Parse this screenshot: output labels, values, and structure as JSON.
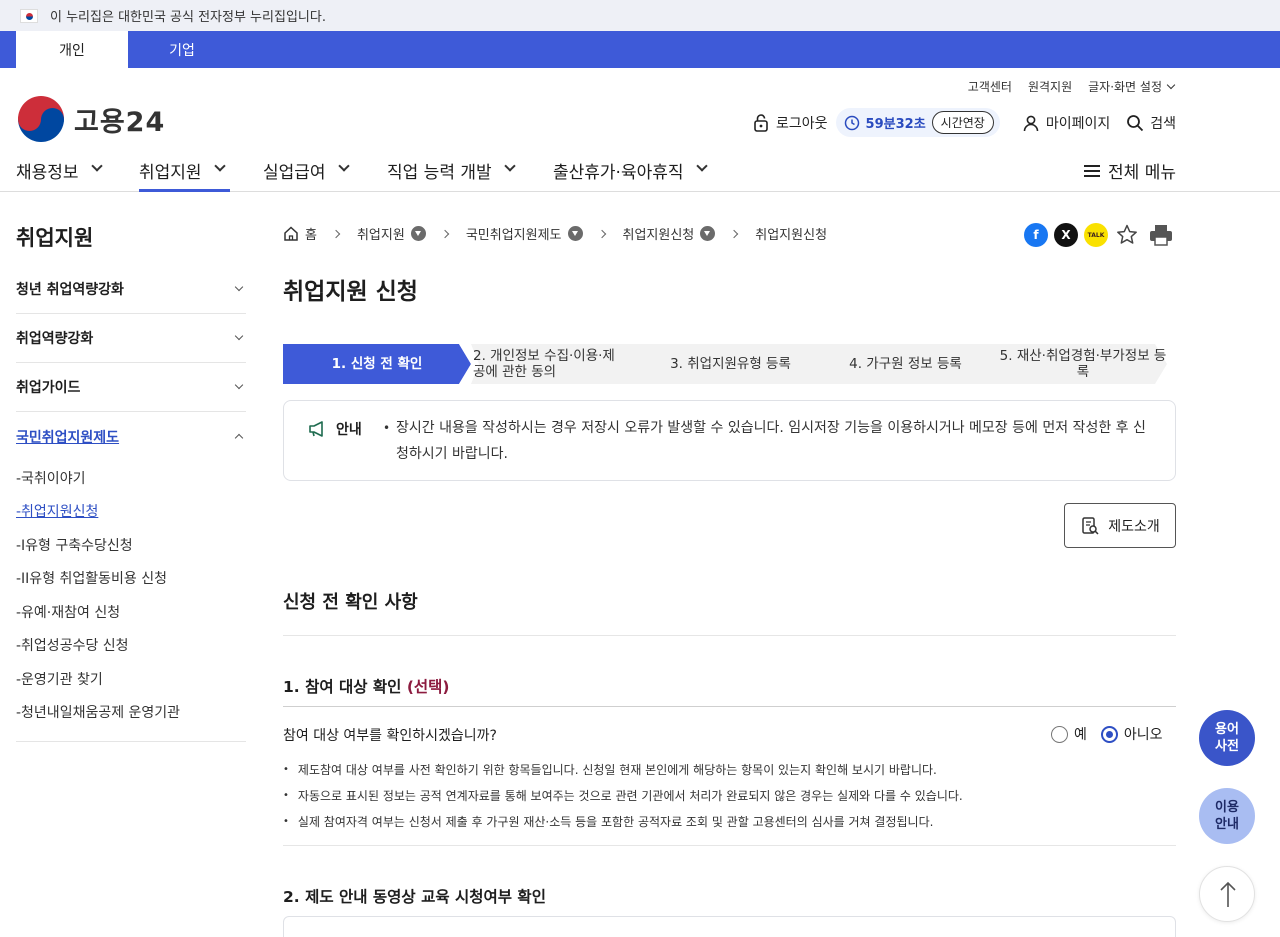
{
  "gov_banner": {
    "text": "이 누리집은 대한민국 공식 전자정부 누리집입니다."
  },
  "user_tabs": [
    {
      "label": "개인",
      "active": true
    },
    {
      "label": "기업",
      "active": false
    }
  ],
  "util_links": {
    "customer_center": "고객센터",
    "remote_support": "원격지원",
    "display_settings": "글자·화면 설정"
  },
  "logo": {
    "text": "고용24"
  },
  "header_actions": {
    "logout": "로그아웃",
    "timer": "59분32초",
    "extend": "시간연장",
    "mypage": "마이페이지",
    "search": "검색"
  },
  "gnb": {
    "items": [
      {
        "label": "채용정보",
        "active": false
      },
      {
        "label": "취업지원",
        "active": true
      },
      {
        "label": "실업급여",
        "active": false
      },
      {
        "label": "직업 능력 개발",
        "active": false
      },
      {
        "label": "출산휴가·육아휴직",
        "active": false
      }
    ],
    "all_menu": "전체 메뉴"
  },
  "lnb": {
    "title": "취업지원",
    "groups": [
      "청년 취업역량강화",
      "취업역량강화",
      "취업가이드",
      "국민취업지원제도"
    ],
    "sub_items": [
      "-국취이야기",
      "-취업지원신청",
      "-I유형 구축수당신청",
      "-II유형 취업활동비용 신청",
      "-유예·재참여 신청",
      "-취업성공수당 신청",
      "-운영기관 찾기",
      "-청년내일채움공제 운영기관"
    ],
    "current_sub": 1
  },
  "breadcrumb": [
    "홈",
    "취업지원",
    "국민취업지원제도",
    "취업지원신청",
    "취업지원신청"
  ],
  "share": {
    "facebook": "f",
    "x": "X",
    "kakao": "TALK"
  },
  "page_title": "취업지원 신청",
  "steps": [
    "1. 신청 전 확인",
    "2. 개인정보 수집·이용·제공에 관한 동의",
    "3. 취업지원유형 등록",
    "4. 가구원 정보 등록",
    "5. 재산·취업경험·부가정보 등록"
  ],
  "notice": {
    "label": "안내",
    "text": "장시간 내용을 작성하시는 경우 저장시 오류가 발생할 수 있습니다. 임시저장 기능을 이용하시거나 메모장 등에 먼저 작성한 후 신청하시기 바랍니다."
  },
  "intro_button": "제도소개",
  "section_title": "신청 전 확인 사항",
  "q1": {
    "title": "1. 참여 대상 확인 ",
    "title_optional": "(선택)",
    "question": "참여 대상 여부를 확인하시겠습니까?",
    "options": [
      {
        "label": "예",
        "selected": false
      },
      {
        "label": "아니오",
        "selected": true
      }
    ],
    "bullets": [
      "제도참여 대상 여부를 사전 확인하기 위한 항목들입니다. 신청일 현재 본인에게 해당하는 항목이 있는지 확인해 보시기 바랍니다.",
      "자동으로 표시된 정보는 공적 연계자료를 통해 보여주는 것으로 관련 기관에서 처리가 완료되지 않은 경우는 실제와 다를 수 있습니다.",
      "실제 참여자격 여부는 신청서 제출 후 가구원 재산·소득 등을 포함한 공적자료 조회 및 관할 고용센터의 심사를 거쳐 결정됩니다."
    ]
  },
  "q2": {
    "title": "2. 제도 안내 동영상 교육 시청여부 확인"
  },
  "floating": {
    "glossary_line1": "용어",
    "glossary_line2": "사전",
    "guide_line1": "이용",
    "guide_line2": "안내"
  },
  "colors": {
    "primary": "#3e5ad8",
    "link": "#2e4fc4",
    "optional": "#8c1b3f",
    "glossary_bg": "#3a55c9",
    "guide_bg": "#a9bdf2"
  }
}
